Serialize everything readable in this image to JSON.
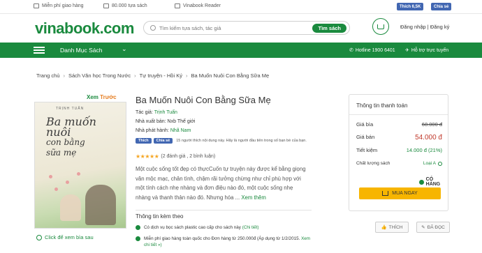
{
  "topbar": {
    "shipping": "Miễn phí giao hàng",
    "titles": "80.000 tựa sách",
    "reader": "Vinabook Reader",
    "fb_like": "Thích 6,5K",
    "fb_share": "Chia sẻ"
  },
  "header": {
    "logo_main": "vinabook",
    "logo_tld": ".com",
    "search_placeholder": "Tìm kiếm tựa sách, tác giả",
    "search_button": "Tìm sách",
    "login": "Đăng nhập | Đăng ký"
  },
  "nav": {
    "categories": "Danh Mục Sách",
    "hotline": "Hotline 1900 6401",
    "support": "Hỗ trợ trực tuyến"
  },
  "breadcrumb": [
    "Trang chủ",
    "Sách Văn học Trong Nước",
    "Tự truyện - Hồi Ký",
    "Ba Muốn Nuôi Con Bằng Sữa Mẹ"
  ],
  "preview": {
    "label_a": "Xem",
    "label_b": "Trước",
    "zoom_link": "Click để xem bìa sau"
  },
  "cover": {
    "author": "TRỊNH TUẤN",
    "title_line1": "Ba muốn",
    "title_line2": "nuôi",
    "title_line3": "con bằng",
    "title_line4": "sữa mẹ"
  },
  "product": {
    "title": "Ba Muốn Nuôi Con Bằng Sữa Mẹ",
    "author_label": "Tác giả:",
    "author": "Trịnh Tuấn",
    "publisher_label": "Nhà xuất bản:",
    "publisher": "Nxb Thế giới",
    "distributor_label": "Nhà phát hành:",
    "distributor": "Nhã Nam",
    "fb_like": "Thích",
    "fb_share": "Chia sẻ",
    "fb_note": "15 người thích nội dung này. Hãy là người đầu tiên trong số bạn bè của bạn.",
    "rating_text": "(2 đánh giá , 2 bình luận)",
    "rating_stars": 5,
    "description": "Một cuộc sống tốt đẹp có thựcCuốn tự truyện này được kể bằng giọng văn mộc mạc, chân tình, chậm rãi tưởng chừng như chỉ phù hợp với một tính cách nhẹ nhàng và đơn điệu nào đó, một cuộc sống nhẹ nhàng và thanh thản nào đó. Nhưng hóa ...",
    "more": "Xem thêm"
  },
  "extras": {
    "title": "Thông tin kèm theo",
    "item1_text": "Có dịch vụ bọc sách plastic cao cấp cho sách này",
    "item1_link": "(Chi tiết)",
    "item2_text": "Miễn phí giao hàng toàn quốc cho Đơn hàng từ 250.000đ (Áp dụng từ 1/2/2015.",
    "item2_link": "Xem chi tiết »)"
  },
  "payment": {
    "title": "Thông tin thanh toán",
    "list_label": "Giá bìa",
    "list_price": "68.000 đ",
    "sale_label": "Giá bán",
    "sale_price": "54.000 đ",
    "save_label": "Tiết kiệm",
    "save_value": "14.000 đ (21%)",
    "quality_label": "Chất lượng sách",
    "quality_value": "Loại A",
    "stock": "CÓ HÀNG",
    "buy": "MUA NGAY",
    "like": "THÍCH",
    "read": "ĐÃ ĐỌC"
  },
  "colors": {
    "brand_green": "#1a8a3e",
    "price_red": "#c0392b",
    "buy_yellow": "#f7b500"
  }
}
